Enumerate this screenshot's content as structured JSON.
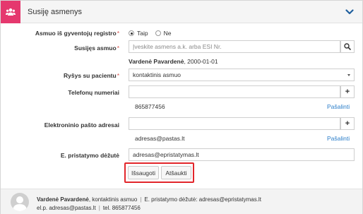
{
  "header": {
    "title": "Susiję asmenys",
    "icon": "users-icon",
    "accent_color": "#e5386e"
  },
  "form": {
    "resident_label": "Asmuo iš gyventojų registro",
    "resident_options": [
      "Taip",
      "Ne"
    ],
    "resident_selected": "Taip",
    "related_person_label": "Susijęs asmuo",
    "related_person_placeholder": "Įveskite asmens a.k. arba ESI Nr.",
    "related_person_name": "Vardenė Pavardenė",
    "related_person_dob": ", 2000-01-01",
    "relation_label": "Ryšys su pacientu",
    "relation_value": "kontaktinis asmuo",
    "phones_label": "Telefonų numeriai",
    "phone_value": "",
    "phone_item": "865877456",
    "phone_remove": "Pašalinti",
    "emails_label": "Elektroninio pašto adresai",
    "email_value": "",
    "email_item": "adresas@pastas.lt",
    "email_remove": "Pašalinti",
    "delivery_label": "E. pristatymo dėžutė",
    "delivery_value": "adresas@epristatymas.lt",
    "add_symbol": "+",
    "required_mark": "*"
  },
  "actions": {
    "save": "Išsaugoti",
    "cancel": "Atšaukti"
  },
  "footer": {
    "name": "Vardenė Pavardenė",
    "role": ", kontaktinis asmuo",
    "delivery_label": "E. pristatymo dėžutė:",
    "delivery_value": "adresas@epristatymas.lt",
    "email_label": "el.p.",
    "email_value": "adresas@pastas.lt",
    "phone_label": "tel.",
    "phone_value": "865877456",
    "separator": "|"
  }
}
